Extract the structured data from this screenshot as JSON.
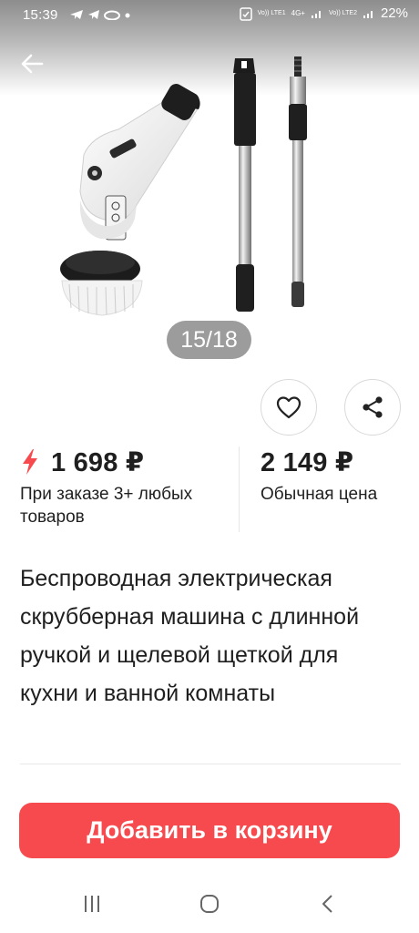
{
  "status_bar": {
    "time": "15:39",
    "sim1_label": "Vo)) LTE1",
    "sim2_label": "Vo)) LTE2",
    "network": "4G+",
    "battery_percent": "22%"
  },
  "gallery": {
    "page_counter": "15/18"
  },
  "prices": {
    "promo_price": "1 698 ₽",
    "promo_caption": "При заказе 3+ любых товаров",
    "regular_price": "2 149 ₽",
    "regular_caption": "Обычная цена",
    "accent_color": "#f64a4e"
  },
  "product": {
    "title": "Беспроводная электрическая скрубберная машина с длинной ручкой и щелевой щеткой для кухни и ванной комнаты"
  },
  "cart": {
    "button_label": "Добавить в корзину"
  },
  "icons": {
    "back": "arrow-left-icon",
    "favorite": "heart-icon",
    "share": "share-icon",
    "promo": "lightning-icon"
  }
}
